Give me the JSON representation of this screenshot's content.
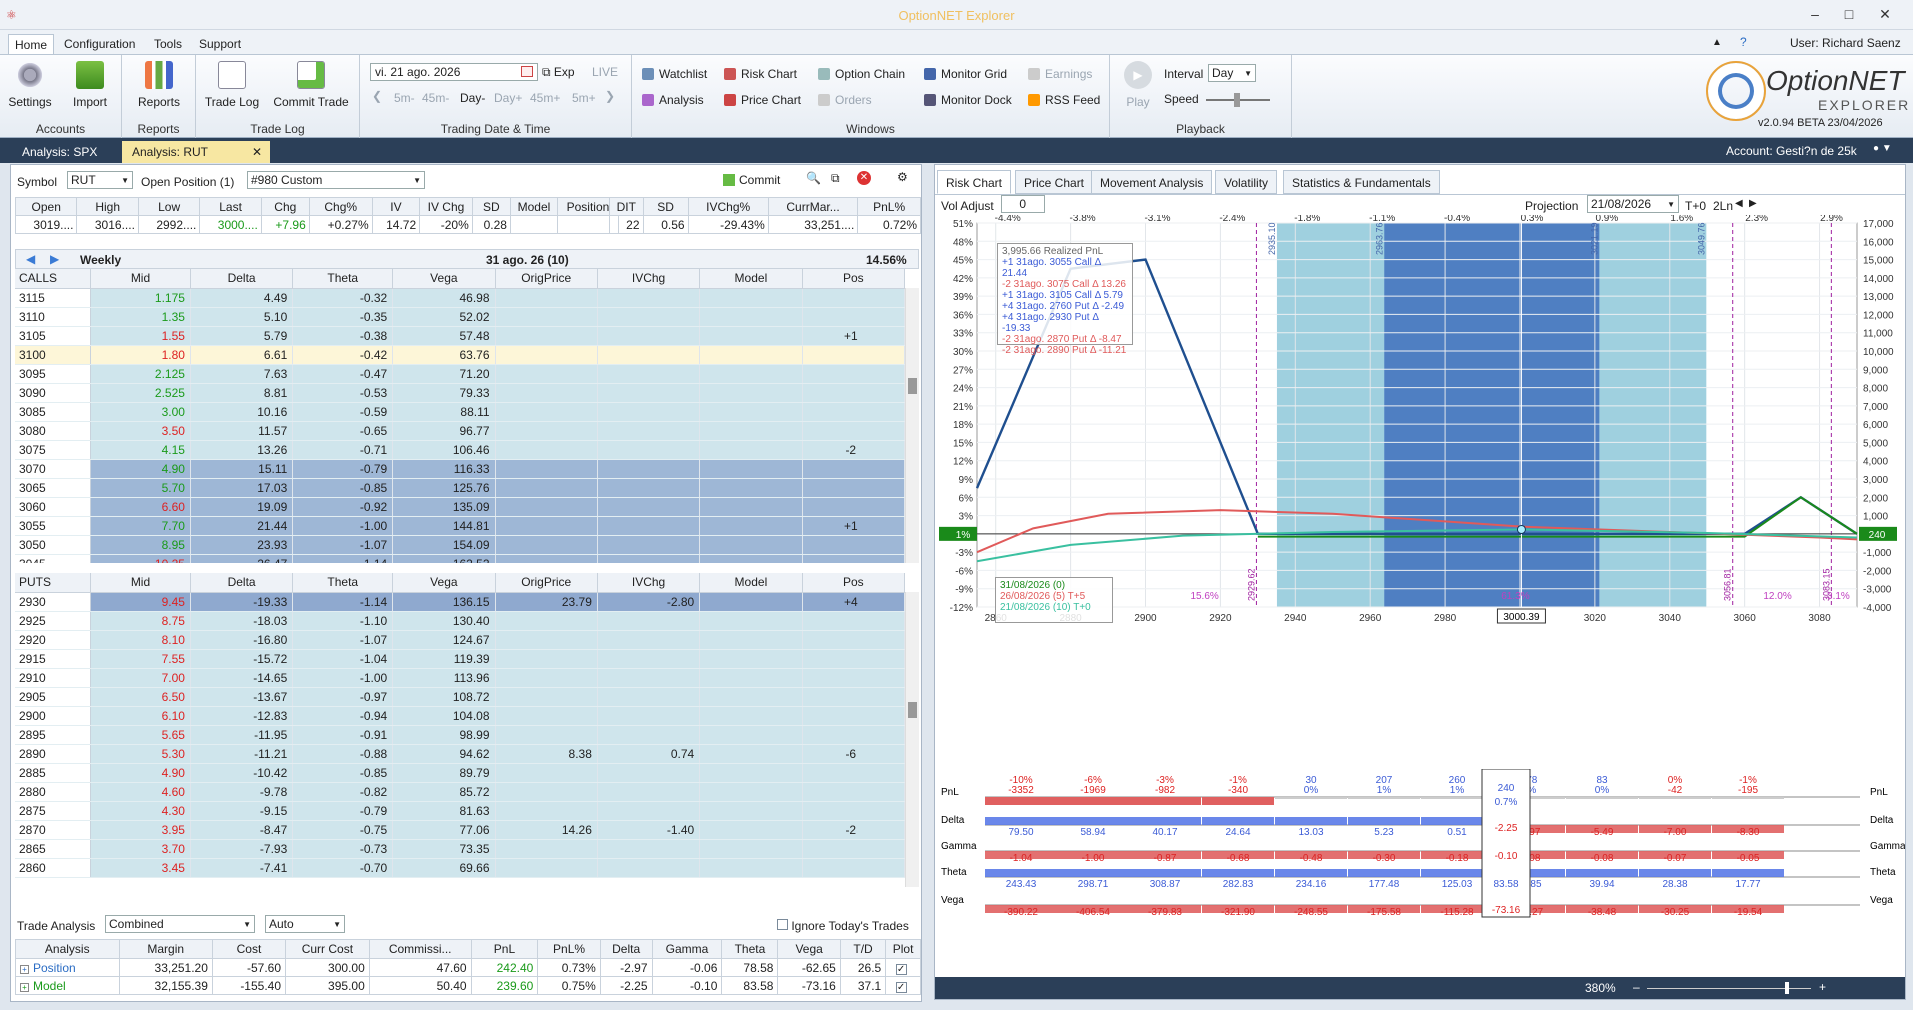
{
  "app": {
    "title": "OptionNET Explorer",
    "user": "User: Richard Saenz"
  },
  "ribbon_tabs": [
    "Home",
    "Configuration",
    "Tools",
    "Support"
  ],
  "ribbon": {
    "accounts": {
      "label": "Accounts",
      "settings": "Settings",
      "import": "Import"
    },
    "reports": {
      "label": "Reports",
      "reports": "Reports"
    },
    "tradelog": {
      "label": "Trade Log",
      "trade_log": "Trade Log",
      "commit_trade": "Commit Trade"
    },
    "trading": {
      "label": "Trading Date & Time",
      "date": "vi. 21 ago. 2026",
      "exp": "Exp",
      "live": "LIVE",
      "steps": [
        "5m-",
        "45m-",
        "Day-",
        "Day+",
        "45m+",
        "5m+"
      ]
    },
    "windows": {
      "label": "Windows",
      "items": [
        "Watchlist",
        "Risk Chart",
        "Option Chain",
        "Monitor Grid",
        "Earnings",
        "Analysis",
        "Price Chart",
        "Orders",
        "Monitor Dock",
        "RSS Feed"
      ]
    },
    "playback": {
      "label": "Playback",
      "play": "Play",
      "interval_label": "Interval",
      "interval": "Day",
      "speed": "Speed"
    },
    "logo": {
      "line1": "OptionNET",
      "line2": "EXPLORER",
      "version": "v2.0.94 BETA 23/04/2026"
    }
  },
  "doc_tabs": [
    "Analysis: SPX",
    "Analysis: RUT"
  ],
  "account": "Account: Gesti?n de 25k",
  "left": {
    "symbol_label": "Symbol",
    "symbol": "RUT",
    "open_pos_label": "Open Position (1)",
    "open_pos": "#980 Custom",
    "commit": "Commit",
    "quote_headers": [
      "Open",
      "High",
      "Low",
      "Last",
      "Chg",
      "Chg%",
      "IV",
      "IV Chg",
      "SD",
      "Model",
      "Position"
    ],
    "quote_values": [
      "3019....",
      "3016....",
      "2992....",
      "3000....",
      "+7.96",
      "+0.27%",
      "14.72",
      "-20%",
      "0.28",
      "",
      ""
    ],
    "pos_headers": [
      "DIT",
      "SD",
      "IVChg%",
      "CurrMar...",
      "PnL%"
    ],
    "pos_values": [
      "22",
      "0.56",
      "-29.43%",
      "33,251....",
      "0.72%"
    ],
    "weekly": "Weekly",
    "expiry": "31 ago. 26 (10)",
    "iv_pct": "14.56%",
    "headers": [
      "Mid",
      "Delta",
      "Theta",
      "Vega",
      "OrigPrice",
      "IVChg",
      "Model",
      "Pos"
    ],
    "calls_label": "CALLS",
    "puts_label": "PUTS",
    "calls": [
      [
        "3115",
        "1.175",
        "4.49",
        "-0.32",
        "46.98",
        "",
        "",
        "",
        ""
      ],
      [
        "3110",
        "1.35",
        "5.10",
        "-0.35",
        "52.02",
        "",
        "",
        "",
        ""
      ],
      [
        "3105",
        "1.55",
        "5.79",
        "-0.38",
        "57.48",
        "",
        "",
        "",
        "+1"
      ],
      [
        "3100",
        "1.80",
        "6.61",
        "-0.42",
        "63.76",
        "",
        "",
        "",
        ""
      ],
      [
        "3095",
        "2.125",
        "7.63",
        "-0.47",
        "71.20",
        "",
        "",
        "",
        ""
      ],
      [
        "3090",
        "2.525",
        "8.81",
        "-0.53",
        "79.33",
        "",
        "",
        "",
        ""
      ],
      [
        "3085",
        "3.00",
        "10.16",
        "-0.59",
        "88.11",
        "",
        "",
        "",
        ""
      ],
      [
        "3080",
        "3.50",
        "11.57",
        "-0.65",
        "96.77",
        "",
        "",
        "",
        ""
      ],
      [
        "3075",
        "4.15",
        "13.26",
        "-0.71",
        "106.46",
        "",
        "",
        "",
        "-2"
      ],
      [
        "3070",
        "4.90",
        "15.11",
        "-0.79",
        "116.33",
        "",
        "",
        "",
        ""
      ],
      [
        "3065",
        "5.70",
        "17.03",
        "-0.85",
        "125.76",
        "",
        "",
        "",
        ""
      ],
      [
        "3060",
        "6.60",
        "19.09",
        "-0.92",
        "135.09",
        "",
        "",
        "",
        ""
      ],
      [
        "3055",
        "7.70",
        "21.44",
        "-1.00",
        "144.81",
        "",
        "",
        "",
        "+1"
      ],
      [
        "3050",
        "8.95",
        "23.93",
        "-1.07",
        "154.09",
        "",
        "",
        "",
        ""
      ],
      [
        "3045",
        "10.25",
        "26.47",
        "-1.14",
        "162.52",
        "",
        "",
        "",
        ""
      ]
    ],
    "puts": [
      [
        "2930",
        "9.45",
        "-19.33",
        "-1.14",
        "136.15",
        "23.79",
        "-2.80",
        "",
        "+4"
      ],
      [
        "2925",
        "8.75",
        "-18.03",
        "-1.10",
        "130.40",
        "",
        "",
        "",
        ""
      ],
      [
        "2920",
        "8.10",
        "-16.80",
        "-1.07",
        "124.67",
        "",
        "",
        "",
        ""
      ],
      [
        "2915",
        "7.55",
        "-15.72",
        "-1.04",
        "119.39",
        "",
        "",
        "",
        ""
      ],
      [
        "2910",
        "7.00",
        "-14.65",
        "-1.00",
        "113.96",
        "",
        "",
        "",
        ""
      ],
      [
        "2905",
        "6.50",
        "-13.67",
        "-0.97",
        "108.72",
        "",
        "",
        "",
        ""
      ],
      [
        "2900",
        "6.10",
        "-12.83",
        "-0.94",
        "104.08",
        "",
        "",
        "",
        ""
      ],
      [
        "2895",
        "5.65",
        "-11.95",
        "-0.91",
        "98.99",
        "",
        "",
        "",
        ""
      ],
      [
        "2890",
        "5.30",
        "-11.21",
        "-0.88",
        "94.62",
        "8.38",
        "0.74",
        "",
        "-6"
      ],
      [
        "2885",
        "4.90",
        "-10.42",
        "-0.85",
        "89.79",
        "",
        "",
        "",
        ""
      ],
      [
        "2880",
        "4.60",
        "-9.78",
        "-0.82",
        "85.72",
        "",
        "",
        "",
        ""
      ],
      [
        "2875",
        "4.30",
        "-9.15",
        "-0.79",
        "81.63",
        "",
        "",
        "",
        ""
      ],
      [
        "2870",
        "3.95",
        "-8.47",
        "-0.75",
        "77.06",
        "14.26",
        "-1.40",
        "",
        "-2"
      ],
      [
        "2865",
        "3.70",
        "-7.93",
        "-0.73",
        "73.35",
        "",
        "",
        "",
        ""
      ],
      [
        "2860",
        "3.45",
        "-7.41",
        "-0.70",
        "69.66",
        "",
        "",
        "",
        ""
      ]
    ],
    "trade_analysis": {
      "label": "Trade Analysis",
      "combined": "Combined",
      "auto": "Auto",
      "ignore": "Ignore Today's Trades",
      "headers": [
        "Analysis",
        "Margin",
        "Cost",
        "Curr Cost",
        "Commissi...",
        "PnL",
        "PnL%",
        "Delta",
        "Gamma",
        "Theta",
        "Vega",
        "T/D",
        "Plot"
      ],
      "rows": [
        [
          "Position",
          "33,251.20",
          "-57.60",
          "300.00",
          "47.60",
          "242.40",
          "0.73%",
          "-2.97",
          "-0.06",
          "78.58",
          "-62.65",
          "26.5"
        ],
        [
          "Model",
          "32,155.39",
          "-155.40",
          "395.00",
          "50.40",
          "239.60",
          "0.75%",
          "-2.25",
          "-0.10",
          "83.58",
          "-73.16",
          "37.1"
        ]
      ]
    }
  },
  "right": {
    "tabs": [
      "Risk Chart",
      "Price Chart",
      "Movement Analysis",
      "Volatility",
      "Statistics & Fundamentals"
    ],
    "vol_adjust_label": "Vol Adjust",
    "vol_adjust": "0",
    "projection_label": "Projection",
    "projection": "21/08/2026",
    "t0": "T+0",
    "ln": "2Ln",
    "legend_title": "3,995.66 Realized PnL",
    "legend": [
      "+1 31ago. 3055 Call Δ  21.44",
      "-2 31ago. 3075 Call Δ  13.26",
      "+1 31ago. 3105 Call Δ  5.79",
      "+4 31ago. 2760 Put Δ  -2.49",
      "+4 31ago. 2930 Put Δ  -19.33",
      "-2 31ago. 2870 Put Δ  -8.47",
      "-2 31ago. 2890 Put Δ  -11.21"
    ],
    "date_legend": [
      "31/08/2026 (0)",
      "26/08/2026 (5) T+5",
      "21/08/2026 (10) T+0"
    ],
    "zoom": "380%",
    "greeks_labels": [
      "PnL",
      "Delta",
      "Gamma",
      "Theta",
      "Vega"
    ],
    "cursor": {
      "price": "3000.39",
      "pnl": "240",
      "pnl_pct": "0.7%",
      "delta": "-2.25",
      "gamma": "-0.10",
      "theta": "83.58",
      "vega": "-73.16"
    }
  },
  "chart_data": {
    "type": "line",
    "x_range": [
      2855,
      3090
    ],
    "x_ticks": [
      2860,
      2880,
      2900,
      2920,
      2940,
      2960,
      2980,
      3000,
      3020,
      3040,
      3060,
      3080
    ],
    "pct_ticks": [
      "-4.4%",
      "-3.8%",
      "-3.1%",
      "-2.4%",
      "-1.8%",
      "-1.1%",
      "-0.4%",
      "0.3%",
      "0.9%",
      "1.6%",
      "2.3%",
      "2.9%"
    ],
    "y_left_ticks": [
      "51%",
      "48%",
      "45%",
      "42%",
      "39%",
      "36%",
      "33%",
      "30%",
      "27%",
      "24%",
      "21%",
      "18%",
      "15%",
      "12%",
      "9%",
      "6%",
      "3%",
      "0%",
      "-3%",
      "-6%",
      "-9%",
      "-12%"
    ],
    "y_right_ticks": [
      "17,000",
      "16,000",
      "15,000",
      "14,000",
      "13,000",
      "12,000",
      "11,000",
      "10,000",
      "9,000",
      "8,000",
      "7,000",
      "6,000",
      "5,000",
      "4,000",
      "3,000",
      "2,000",
      "1,000",
      "0",
      "-1,000",
      "-2,000",
      "-3,000",
      "-4,000"
    ],
    "y_range": [
      -4000,
      17000
    ],
    "sd_lines": [
      {
        "x": 2929.62,
        "label": "2929.62"
      },
      {
        "x": 3056.81,
        "label": "3056.81"
      },
      {
        "x": 3083.15,
        "label": "3083.15"
      }
    ],
    "bands": [
      {
        "x0": 2935.1,
        "x1": 3049.76,
        "color": "#9fd0df",
        "labels": [
          "2935.10",
          "3049.76"
        ]
      },
      {
        "x0": 2963.76,
        "x1": 3021.19,
        "color": "#4f7fc2",
        "labels": [
          "2963.76",
          "3021.19"
        ]
      }
    ],
    "band_pct": [
      "15.6%",
      "61.3%",
      "12.0%",
      "3.1%"
    ],
    "pnl_label": "1%",
    "right_label": "240",
    "series": [
      {
        "name": "31/08/2026 (0)",
        "color": "#1f4f8f",
        "points": [
          [
            2855,
            2500
          ],
          [
            2880,
            14500
          ],
          [
            2900,
            15000
          ],
          [
            2930,
            0
          ],
          [
            3060,
            0
          ],
          [
            3075,
            2000
          ],
          [
            3090,
            0
          ]
        ]
      },
      {
        "name": "Expiration",
        "color": "#1a8a1a",
        "points": [
          [
            2930,
            -150
          ],
          [
            3060,
            -150
          ],
          [
            3075,
            2000
          ],
          [
            3090,
            0
          ]
        ]
      },
      {
        "name": "26/08/2026 (5) T+5",
        "color": "#e05a5a",
        "points": [
          [
            2855,
            -1000
          ],
          [
            2870,
            300
          ],
          [
            2890,
            1100
          ],
          [
            2920,
            1300
          ],
          [
            2950,
            1100
          ],
          [
            3000,
            400
          ],
          [
            3040,
            100
          ],
          [
            3080,
            -200
          ],
          [
            3090,
            -300
          ]
        ]
      },
      {
        "name": "21/08/2026 (10) T+0",
        "color": "#3ac0a0",
        "points": [
          [
            2855,
            -1500
          ],
          [
            2880,
            -600
          ],
          [
            2910,
            -100
          ],
          [
            2950,
            100
          ],
          [
            3000,
            240
          ],
          [
            3050,
            50
          ],
          [
            3090,
            -200
          ]
        ]
      }
    ],
    "greek_rows": {
      "pnl": [
        [
          "-10%",
          "-3352"
        ],
        [
          "-6%",
          "-1969"
        ],
        [
          "-3%",
          "-982"
        ],
        [
          "-1%",
          "-340"
        ],
        [
          "30",
          "0%"
        ],
        [
          "207",
          "1%"
        ],
        [
          "260",
          "1%"
        ],
        [
          "",
          ""
        ],
        [
          "178",
          "1%"
        ],
        [
          "83",
          "0%"
        ],
        [
          "0%",
          "-42"
        ],
        [
          "-1%",
          "-195"
        ]
      ],
      "delta": [
        "79.50",
        "58.94",
        "40.17",
        "24.64",
        "13.03",
        "5.23",
        "0.51",
        "",
        "-3.97",
        "-5.49",
        "-7.00",
        "-8.30"
      ],
      "gamma": [
        "-1.04",
        "-1.00",
        "-0.87",
        "-0.68",
        "-0.48",
        "-0.30",
        "-0.18",
        "",
        "-0.08",
        "-0.08",
        "-0.07",
        "-0.05"
      ],
      "theta": [
        "243.43",
        "298.71",
        "308.87",
        "282.83",
        "234.16",
        "177.48",
        "125.03",
        "",
        "56.85",
        "39.94",
        "28.38",
        "17.77"
      ],
      "vega": [
        "-390.22",
        "-406.54",
        "-379.83",
        "-321.90",
        "-248.55",
        "-175.58",
        "-115.28",
        "",
        "-50.27",
        "-38.48",
        "-30.25",
        "-19.54"
      ]
    }
  }
}
